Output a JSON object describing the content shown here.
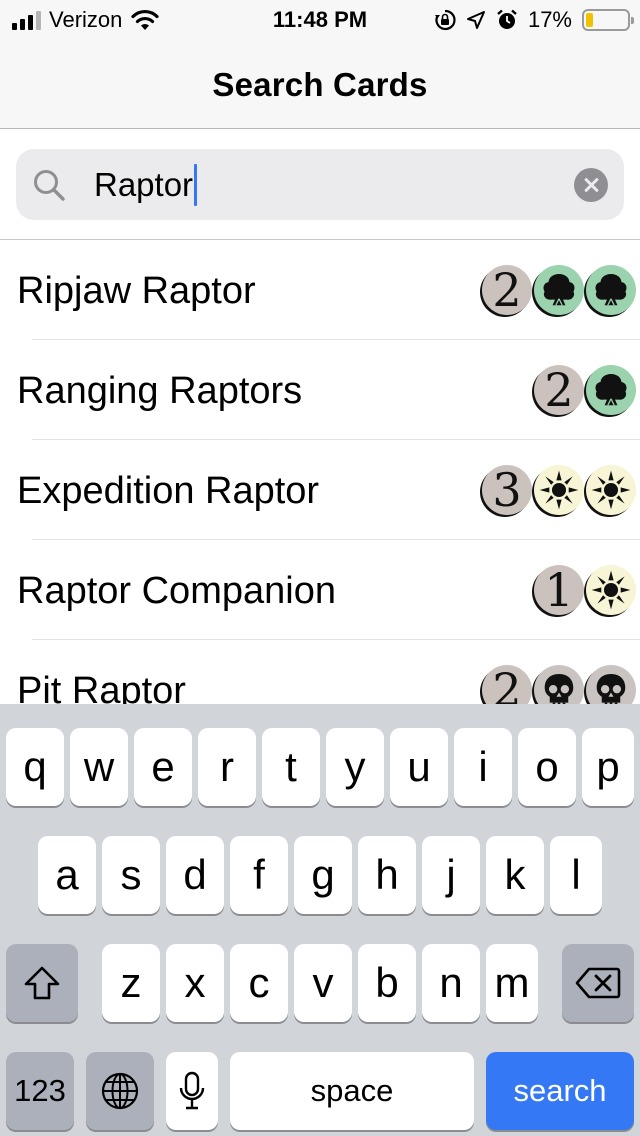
{
  "status_bar": {
    "carrier": "Verizon",
    "time": "11:48 PM",
    "battery_percent": "17%",
    "battery_level": 0.17,
    "icons": [
      "signal-icon",
      "wifi-icon",
      "orientation-lock-icon",
      "location-icon",
      "alarm-icon",
      "battery-icon"
    ]
  },
  "nav": {
    "title": "Search Cards"
  },
  "search": {
    "value": "Raptor",
    "icon": "search-icon",
    "clear_icon": "clear-icon"
  },
  "results": [
    {
      "name": "Ripjaw Raptor",
      "mana": [
        "2",
        "G",
        "G"
      ]
    },
    {
      "name": "Ranging Raptors",
      "mana": [
        "2",
        "G"
      ]
    },
    {
      "name": "Expedition Raptor",
      "mana": [
        "3",
        "W",
        "W"
      ]
    },
    {
      "name": "Raptor Companion",
      "mana": [
        "1",
        "W"
      ]
    },
    {
      "name": "Pit Raptor",
      "mana": [
        "2",
        "B",
        "B"
      ]
    }
  ],
  "colors": {
    "accent": "#3478f6",
    "mana_green": "#9bd3ae",
    "mana_white": "#f8f5d6",
    "mana_black": "#c9c4c1",
    "mana_generic": "#cbc2bd"
  },
  "keyboard": {
    "row1": [
      "q",
      "w",
      "e",
      "r",
      "t",
      "y",
      "u",
      "i",
      "o",
      "p"
    ],
    "row2": [
      "a",
      "s",
      "d",
      "f",
      "g",
      "h",
      "j",
      "k",
      "l"
    ],
    "row3": [
      "z",
      "x",
      "c",
      "v",
      "b",
      "n",
      "m"
    ],
    "shift_icon": "shift-icon",
    "delete_icon": "delete-icon",
    "numbers_label": "123",
    "globe_icon": "globe-icon",
    "mic_icon": "microphone-icon",
    "space_label": "space",
    "action_label": "search"
  }
}
